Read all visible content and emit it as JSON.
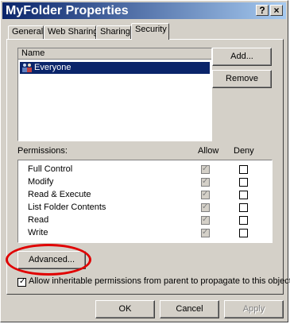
{
  "window": {
    "title": "MyFolder Properties",
    "help_glyph": "?",
    "close_glyph": "×"
  },
  "tabs": [
    {
      "label": "General"
    },
    {
      "label": "Web Sharing"
    },
    {
      "label": "Sharing"
    },
    {
      "label": "Security"
    }
  ],
  "names_list": {
    "header": "Name",
    "items": [
      {
        "label": "Everyone",
        "selected": true
      }
    ]
  },
  "buttons": {
    "add": "Add...",
    "remove": "Remove",
    "advanced": "Advanced...",
    "ok": "OK",
    "cancel": "Cancel",
    "apply": "Apply"
  },
  "permissions": {
    "label": "Permissions:",
    "allow_label": "Allow",
    "deny_label": "Deny",
    "rows": [
      {
        "name": "Full Control",
        "allow": true,
        "deny": false
      },
      {
        "name": "Modify",
        "allow": true,
        "deny": false
      },
      {
        "name": "Read & Execute",
        "allow": true,
        "deny": false
      },
      {
        "name": "List Folder Contents",
        "allow": true,
        "deny": false
      },
      {
        "name": "Read",
        "allow": true,
        "deny": false
      },
      {
        "name": "Write",
        "allow": true,
        "deny": false
      }
    ]
  },
  "inherit": {
    "label": "Allow inheritable permissions from parent to propagate to this object",
    "checked": true
  },
  "colors": {
    "title_bar": "#0a246a",
    "selection": "#0a246a",
    "highlight_ring": "#e00000"
  }
}
